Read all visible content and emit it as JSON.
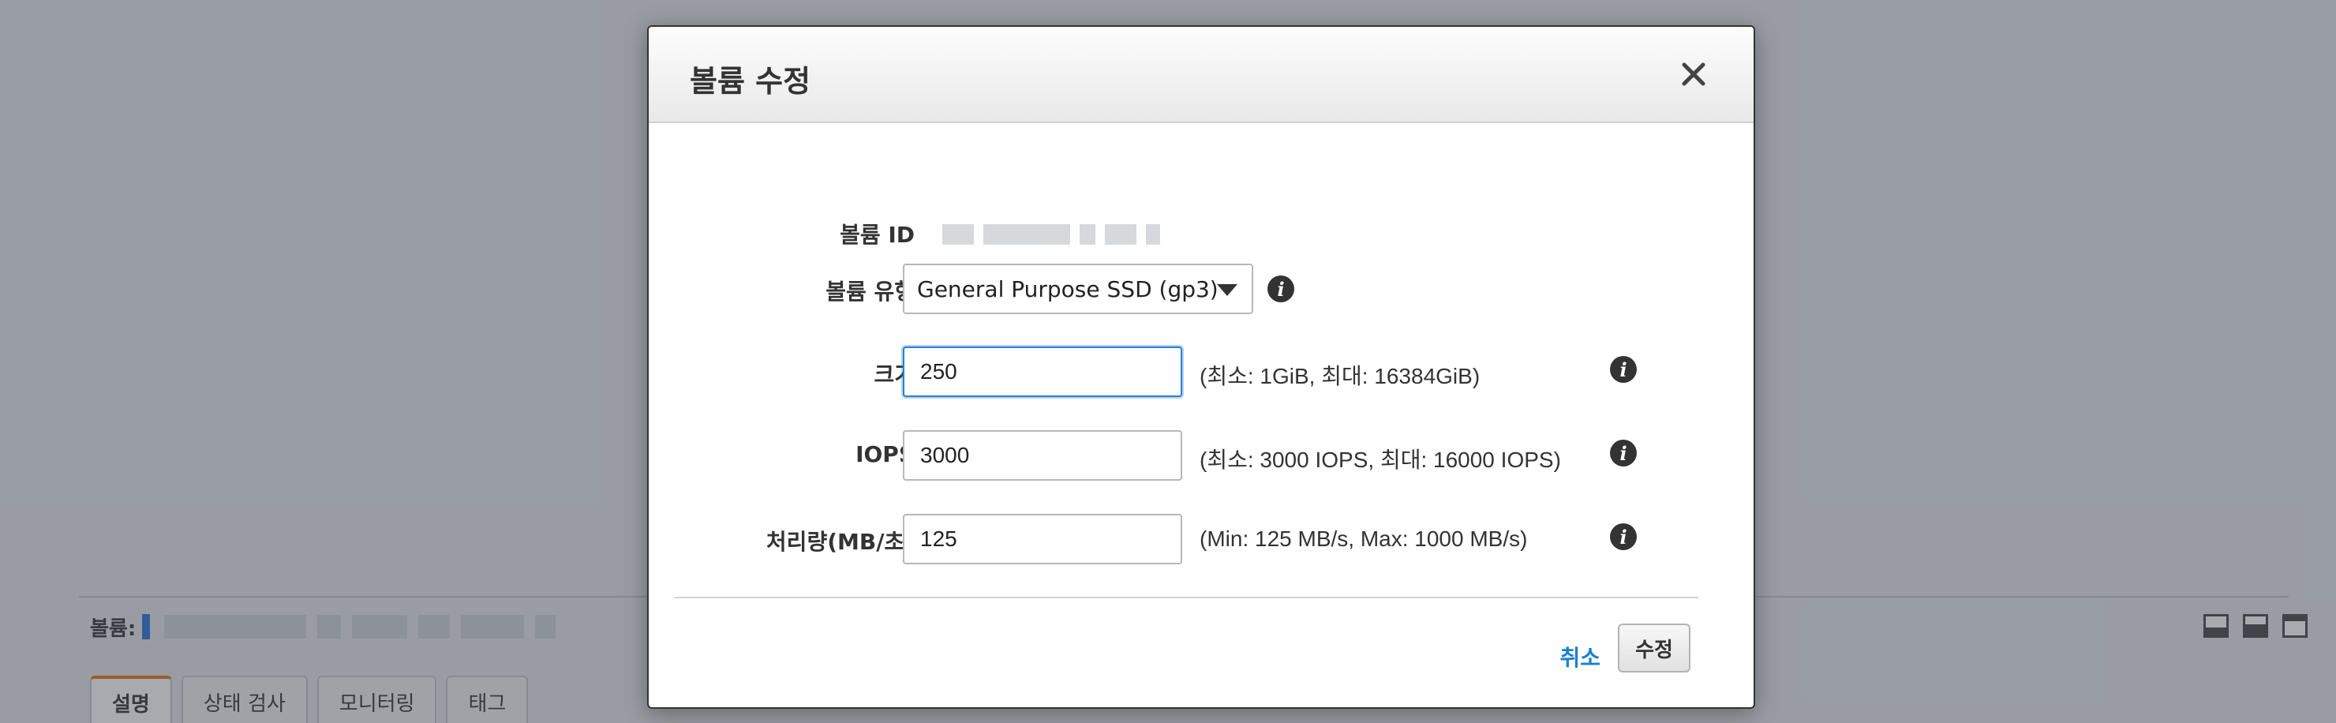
{
  "background": {
    "volume_bar_label": "볼륨:",
    "tabs": [
      {
        "label": "설명",
        "active": true
      },
      {
        "label": "상태 검사",
        "active": false
      },
      {
        "label": "모니터링",
        "active": false
      },
      {
        "label": "태그",
        "active": false
      }
    ]
  },
  "modal": {
    "title": "볼륨 수정",
    "fields": {
      "volume_id": {
        "label": "볼륨 ID"
      },
      "volume_type": {
        "label": "볼륨 유형",
        "value": "General Purpose SSD (gp3)"
      },
      "size": {
        "label": "크기",
        "value": "250",
        "hint": "(최소: 1GiB, 최대: 16384GiB)"
      },
      "iops": {
        "label": "IOPS",
        "value": "3000",
        "hint": "(최소: 3000 IOPS, 최대: 16000 IOPS)"
      },
      "throughput": {
        "label": "처리량(MB/초)",
        "value": "125",
        "hint": "(Min: 125 MB/s, Max: 1000 MB/s)"
      }
    },
    "cancel_label": "취소",
    "submit_label": "수정"
  },
  "colors": {
    "link": "#1a7fd4",
    "focus_border": "#2c7fd6",
    "active_tab_accent": "#ec7211"
  }
}
